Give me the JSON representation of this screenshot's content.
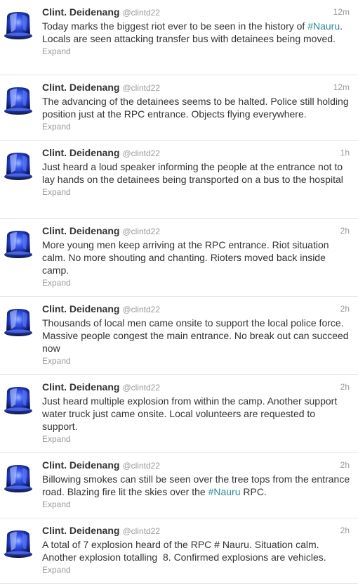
{
  "tweets": [
    {
      "name": "Clint. Deidenang",
      "handle": "@clintd22",
      "time": "12m",
      "text_before": "Today marks the biggest riot ever to be seen in the history of ",
      "hashtag": "#Nauru",
      "text_after": ". Locals are seen attacking transfer bus with detainees being moved.",
      "expand": "Expand"
    },
    {
      "name": "Clint. Deidenang",
      "handle": "@clintd22",
      "time": "12m",
      "text": "The advancing of the detainees seems to be halted. Police still holding position just at the RPC entrance. Objects flying everywhere.",
      "expand": "Expand"
    },
    {
      "name": "Clint. Deidenang",
      "handle": "@clintd22",
      "time": "1h",
      "text": "Just heard a loud speaker informing the people at the entrance not to lay hands on the detainees being transported on a bus to the hospital",
      "expand": "Expand"
    },
    {
      "name": "Clint. Deidenang",
      "handle": "@clintd22",
      "time": "2h",
      "text": "More young men keep arriving at the RPC entrance. Riot situation calm. No more shouting and chanting. Rioters moved back inside camp.",
      "expand": "Expand"
    },
    {
      "name": "Clint. Deidenang",
      "handle": "@clintd22",
      "time": "2h",
      "text": "Thousands of local men came onsite to support the local police force. Massive people congest the main entrance. No break out can succeed now",
      "expand": "Expand"
    },
    {
      "name": "Clint. Deidenang",
      "handle": "@clintd22",
      "time": "2h",
      "text": "Just heard multiple explosion from within the camp. Another support water truck just came onsite. Local volunteers are requested to support.",
      "expand": "Expand"
    },
    {
      "name": "Clint. Deidenang",
      "handle": "@clintd22",
      "time": "2h",
      "text_before": "Billowing smokes can still be seen over the tree tops from the entrance road. Blazing fire lit the skies over the ",
      "hashtag": "#Nauru",
      "text_after": " RPC.",
      "expand": "Expand"
    },
    {
      "name": "Clint. Deidenang",
      "handle": "@clintd22",
      "time": "2h",
      "text": "A total of 7 explosion heard of the RPC # Nauru. Situation calm. Another explosion totalling  8. Confirmed explosions are vehicles.",
      "expand": "Expand"
    }
  ],
  "colors": {
    "hashtag": "#2b8a94",
    "muted": "#999999",
    "text": "#333333",
    "siren_blue": "#1f3fd0"
  },
  "icons": {
    "avatar": "blue-siren-icon"
  }
}
